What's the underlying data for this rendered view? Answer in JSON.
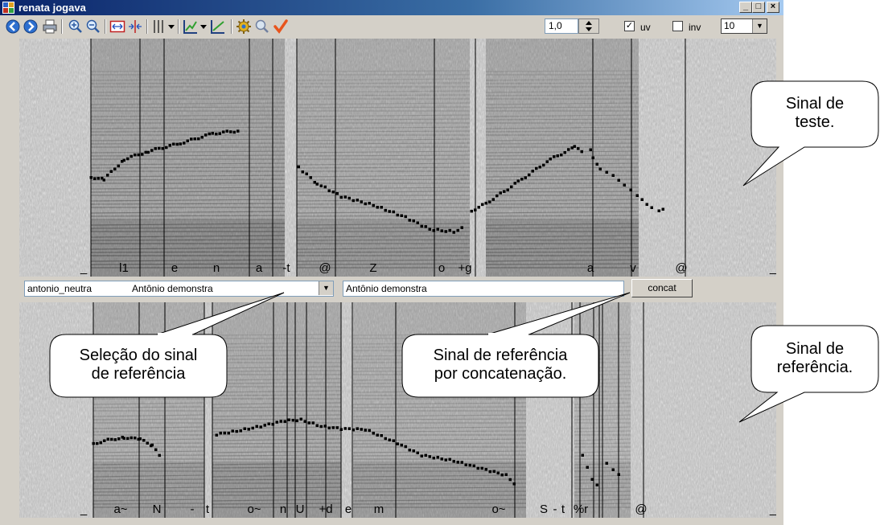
{
  "window": {
    "title": "renata jogava",
    "minimize": "_",
    "maximize": "□",
    "close": "×"
  },
  "toolbar": {
    "icons": [
      "globe-back-icon",
      "globe-forward-icon",
      "print-icon",
      "zoom-in-icon",
      "zoom-out-icon",
      "fit-width-icon",
      "split-icon",
      "vertical-lines-icon",
      "chart-icon",
      "chart-line-icon",
      "settings-icon",
      "search-icon",
      "check-icon"
    ],
    "zoom_value": "1,0",
    "uv_label": "uv",
    "uv_checked": true,
    "inv_label": "inv",
    "inv_checked": false,
    "count_value": "10"
  },
  "top_pane": {
    "phonemes": [
      "_",
      "l1",
      "e",
      "n",
      "a",
      "-t",
      "@",
      "Z",
      "o",
      "+g",
      "a",
      "v",
      "@",
      "_"
    ]
  },
  "mid_row": {
    "ref_select_name": "antonio_neutra",
    "ref_select_text": "Antônio demonstra",
    "ref_text": "Antônio demonstra",
    "concat_label": "concat"
  },
  "bottom_pane": {
    "phonemes": [
      "_",
      "a~",
      "N",
      "-",
      "t",
      "o~",
      "n",
      "U",
      "+d",
      "e",
      "m",
      "o~",
      "S",
      "-",
      "t",
      "%r",
      "@",
      "_"
    ]
  },
  "callouts": {
    "test": "Sinal de\nteste.",
    "reference": "Sinal de\nreferência.",
    "selection": "Seleção do sinal\nde referência",
    "concatenation": "Sinal de referência\npor concatenação."
  },
  "colors": {
    "title_start": "#0a246a",
    "title_end": "#a6caf0",
    "window_bg": "#d4d0c8",
    "check_icon": "#e8541c"
  }
}
